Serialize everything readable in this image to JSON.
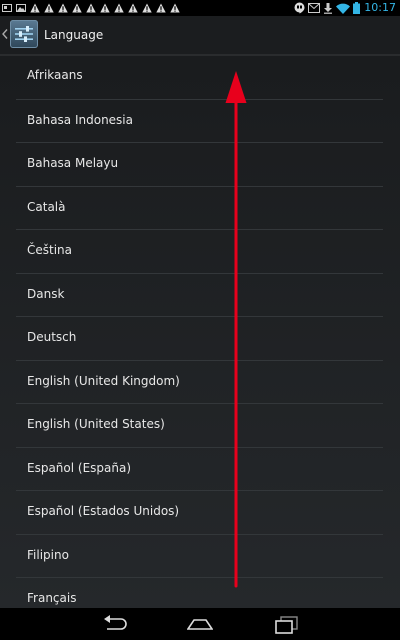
{
  "status_bar": {
    "time": "10:17",
    "notification_icons": [
      "photo-icon",
      "image-icon",
      "warning-icon",
      "warning-icon",
      "warning-icon",
      "warning-icon",
      "warning-icon",
      "warning-icon",
      "warning-icon",
      "warning-icon",
      "warning-icon",
      "warning-icon",
      "warning-icon",
      "hangouts-icon",
      "gmail-icon",
      "download-icon",
      "wifi-icon",
      "battery-icon"
    ]
  },
  "action_bar": {
    "title": "Language"
  },
  "languages": [
    {
      "label": "Afrikaans"
    },
    {
      "label": "Bahasa Indonesia"
    },
    {
      "label": "Bahasa Melayu"
    },
    {
      "label": "Català"
    },
    {
      "label": "Čeština"
    },
    {
      "label": "Dansk"
    },
    {
      "label": "Deutsch"
    },
    {
      "label": "English (United Kingdom)"
    },
    {
      "label": "English (United States)"
    },
    {
      "label": "Español (España)"
    },
    {
      "label": "Español (Estados Unidos)"
    },
    {
      "label": "Filipino"
    },
    {
      "label": "Français"
    }
  ],
  "colors": {
    "accent": "#33b5e5",
    "annotation": "#e8001c"
  }
}
